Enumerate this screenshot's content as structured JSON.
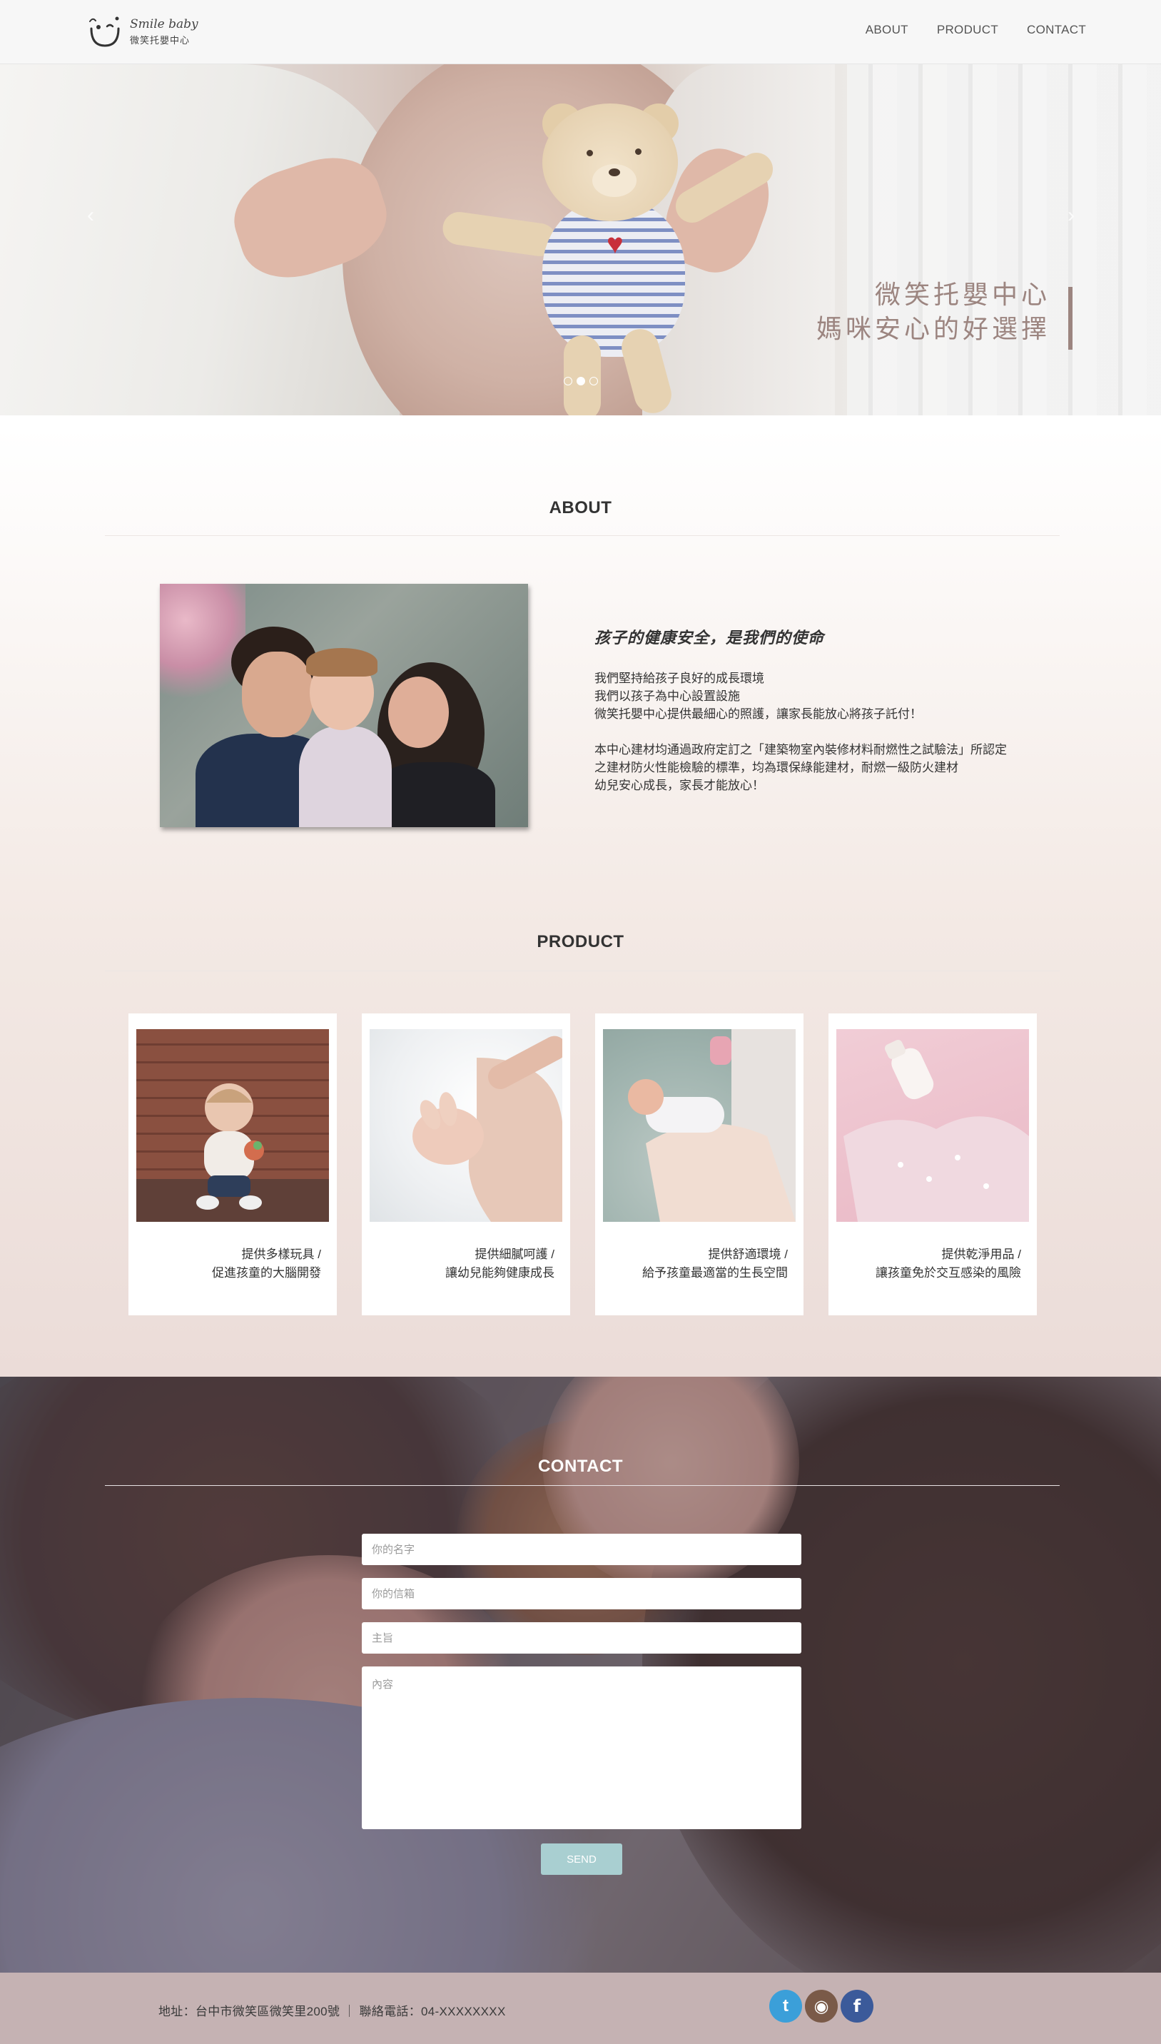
{
  "nav": {
    "logo_en": "Smile baby",
    "logo_zh": "微笑托嬰中心",
    "links": [
      "ABOUT",
      "PRODUCT",
      "CONTACT"
    ]
  },
  "hero": {
    "title": "微笑托嬰中心",
    "subtitle": "媽咪安心的好選擇",
    "prev_arrow": "‹",
    "next_arrow": "›",
    "slide_count": 3,
    "active_slide": 1
  },
  "about": {
    "section_title": "ABOUT",
    "heading": "孩子的健康安全，是我們的使命",
    "paragraph1": [
      "我們堅持給孩子良好的成長環境",
      "我們以孩子為中心設置設施",
      "微笑托嬰中心提供最細心的照護，讓家長能放心將孩子託付！"
    ],
    "paragraph2": [
      "本中心建材均通過政府定訂之「建築物室內裝修材料耐燃性之試驗法」所認定",
      "之建材防火性能檢驗的標準，均為環保綠能建材，耐燃一級防火建材",
      "幼兒安心成長，家長才能放心！"
    ]
  },
  "product": {
    "section_title": "PRODUCT",
    "cards": [
      {
        "line1": "提供多樣玩具 /",
        "line2": "促進孩童的大腦開發"
      },
      {
        "line1": "提供細膩呵護 /",
        "line2": "讓幼兒能夠健康成長"
      },
      {
        "line1": "提供舒適環境 /",
        "line2": "給予孩童最適當的生長空間"
      },
      {
        "line1": "提供乾淨用品 /",
        "line2": "讓孩童免於交互感染的風險"
      }
    ]
  },
  "contact": {
    "section_title": "CONTACT",
    "name_placeholder": "你的名字",
    "email_placeholder": "你的信箱",
    "subject_placeholder": "主旨",
    "message_placeholder": "內容",
    "send_label": "SEND"
  },
  "footer": {
    "text": "地址：台中市微笑區微笑里200號 ｜ 聯絡電話：04-XXXXXXXX",
    "social": [
      {
        "icon": "twitter-icon",
        "glyph": "t"
      },
      {
        "icon": "instagram-icon",
        "glyph": "◉"
      },
      {
        "icon": "facebook-icon",
        "glyph": "f"
      }
    ]
  },
  "colors": {
    "accent_caption": "#9c8580",
    "send_button": "#a9cfd1",
    "footer_bg": "#c5b2b3",
    "twitter": "#3b9fd9",
    "facebook": "#3b5a9a"
  }
}
